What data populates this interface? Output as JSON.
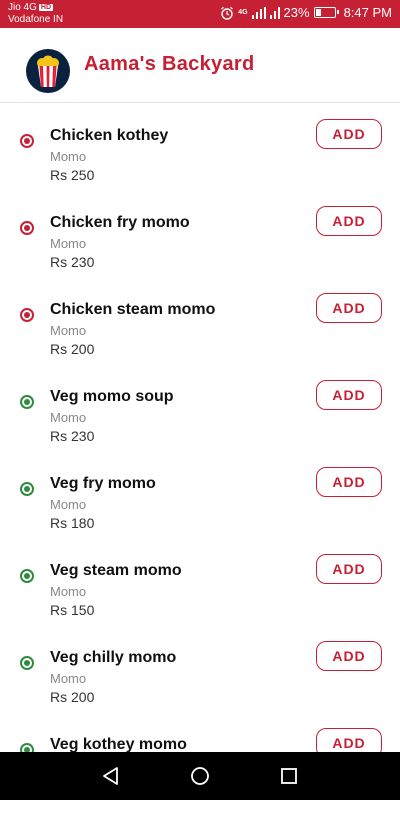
{
  "status_bar": {
    "carrier_line1": "Jio 4G",
    "lte_badge": "HD",
    "carrier_line2": "Vodafone IN",
    "network_badge": "4G",
    "battery_percent": "23%",
    "time": "8:47 PM"
  },
  "header": {
    "title": "Aama's Backyard"
  },
  "menu": {
    "items": [
      {
        "name": "Chicken kothey",
        "category": "Momo",
        "price": "Rs 250",
        "add_label": "ADD",
        "type": "nonveg"
      },
      {
        "name": "Chicken fry momo",
        "category": "Momo",
        "price": "Rs 230",
        "add_label": "ADD",
        "type": "nonveg"
      },
      {
        "name": "Chicken steam momo",
        "category": "Momo",
        "price": "Rs 200",
        "add_label": "ADD",
        "type": "nonveg"
      },
      {
        "name": "Veg momo soup",
        "category": "Momo",
        "price": "Rs 230",
        "add_label": "ADD",
        "type": "veg"
      },
      {
        "name": "Veg fry momo",
        "category": "Momo",
        "price": "Rs 180",
        "add_label": "ADD",
        "type": "veg"
      },
      {
        "name": "Veg steam momo",
        "category": "Momo",
        "price": "Rs 150",
        "add_label": "ADD",
        "type": "veg"
      },
      {
        "name": "Veg chilly momo",
        "category": "Momo",
        "price": "Rs 200",
        "add_label": "ADD",
        "type": "veg"
      },
      {
        "name": "Veg kothey momo",
        "category": "",
        "price": "",
        "add_label": "ADD",
        "type": "veg"
      }
    ]
  },
  "colors": {
    "brand": "#c62034",
    "veg": "#2e8b3d",
    "nonveg": "#c62034"
  },
  "icons": {
    "nav_back": "back-triangle-icon",
    "nav_home": "home-circle-icon",
    "nav_recents": "recents-square-icon"
  }
}
